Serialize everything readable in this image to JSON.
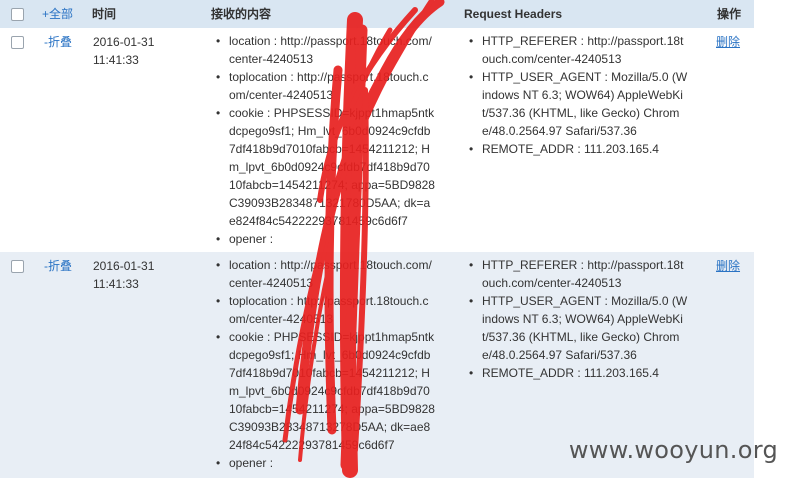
{
  "header": {
    "select_all": "+全部",
    "time": "时间",
    "received": "接收的内容",
    "request_headers": "Request Headers",
    "actions": "操作"
  },
  "rows": [
    {
      "fold_label": "-折叠",
      "date": "2016-01-31",
      "time": "11:41:33",
      "received": [
        "location : http://passport.18touch.com/center-4240513",
        "toplocation : http://passport.18touch.com/center-4240513",
        "cookie : PHPSESSID=kjppt1hmap5ntkdcpego9sf1; Hm_lvt_6b0d0924c9cfdb7df418b9d7010fabcb=1454211212; Hm_lpvt_6b0d0924c9cfdb7df418b9d7010fabcb=1454211274; appa=5BD9828C39093B2834871321780D5AA; dk=ae824f84c54222293781459c6d6f7",
        "opener :"
      ],
      "headers": [
        "HTTP_REFERER : http://passport.18touch.com/center-4240513",
        "HTTP_USER_AGENT : Mozilla/5.0 (Windows NT 6.3; WOW64) AppleWebKit/537.36 (KHTML, like Gecko) Chrome/48.0.2564.97 Safari/537.36",
        "REMOTE_ADDR : 111.203.165.4"
      ],
      "delete_label": "删除"
    },
    {
      "fold_label": "-折叠",
      "date": "2016-01-31",
      "time": "11:41:33",
      "received": [
        "location : http://passport.18touch.com/center-4240513",
        "toplocation : http://passport.18touch.com/center-4240513",
        "cookie : PHPSESSID=kjppt1hmap5ntkdcpego9sf1; Hm_lvt_6b0d0924c9cfdb7df418b9d7010fabcb=1454211212; Hm_lpvt_6b0d0924c9cfdb7df418b9d7010fabcb=1454211274; appa=5BD9828C39093B28348713278D5AA; dk=ae824f84c54222293781459c6d6f7",
        "opener :"
      ],
      "headers": [
        "HTTP_REFERER : http://passport.18touch.com/center-4240513",
        "HTTP_USER_AGENT : Mozilla/5.0 (Windows NT 6.3; WOW64) AppleWebKit/537.36 (KHTML, like Gecko) Chrome/48.0.2564.97 Safari/537.36",
        "REMOTE_ADDR : 111.203.165.4"
      ],
      "delete_label": "删除"
    }
  ],
  "watermark": "www.wooyun.org",
  "colors": {
    "header_bg": "#d9e6f2",
    "alt_row_bg": "#e8eef5",
    "link": "#2a73c4",
    "scribble": "#e8201f"
  }
}
